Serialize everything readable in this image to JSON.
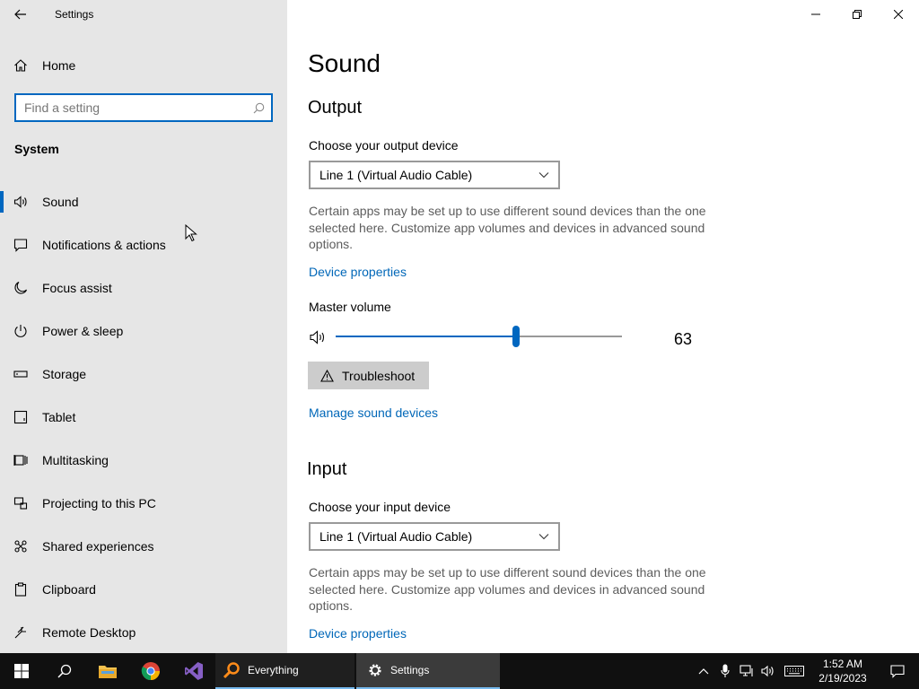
{
  "window": {
    "app_title": "Settings"
  },
  "sidebar": {
    "home_label": "Home",
    "search_placeholder": "Find a setting",
    "section_heading": "System",
    "items": [
      {
        "label": "Sound",
        "icon": "speaker-icon",
        "selected": true
      },
      {
        "label": "Notifications & actions",
        "icon": "notification-icon",
        "selected": false
      },
      {
        "label": "Focus assist",
        "icon": "moon-icon",
        "selected": false
      },
      {
        "label": "Power & sleep",
        "icon": "power-icon",
        "selected": false
      },
      {
        "label": "Storage",
        "icon": "storage-icon",
        "selected": false
      },
      {
        "label": "Tablet",
        "icon": "tablet-icon",
        "selected": false
      },
      {
        "label": "Multitasking",
        "icon": "multitasking-icon",
        "selected": false
      },
      {
        "label": "Projecting to this PC",
        "icon": "projecting-icon",
        "selected": false
      },
      {
        "label": "Shared experiences",
        "icon": "shared-experiences-icon",
        "selected": false
      },
      {
        "label": "Clipboard",
        "icon": "clipboard-icon",
        "selected": false
      },
      {
        "label": "Remote Desktop",
        "icon": "remote-desktop-icon",
        "selected": false
      }
    ]
  },
  "main": {
    "page_title": "Sound",
    "output": {
      "heading": "Output",
      "device_label": "Choose your output device",
      "device_value": "Line 1 (Virtual Audio Cable)",
      "description": "Certain apps may be set up to use different sound devices than the one selected here. Customize app volumes and devices in advanced sound options.",
      "device_properties_link": "Device properties",
      "master_volume_label": "Master volume",
      "master_volume_value": "63",
      "troubleshoot_label": "Troubleshoot",
      "manage_devices_link": "Manage sound devices"
    },
    "input": {
      "heading": "Input",
      "device_label": "Choose your input device",
      "device_value": "Line 1 (Virtual Audio Cable)",
      "description": "Certain apps may be set up to use different sound devices than the one selected here. Customize app volumes and devices in advanced sound options.",
      "device_properties_link": "Device properties"
    }
  },
  "taskbar": {
    "apps": [
      {
        "label": "Everything",
        "icon": "everything-icon"
      },
      {
        "label": "Settings",
        "icon": "settings-gear-icon"
      }
    ],
    "clock_time": "1:52 AM",
    "clock_date": "2/19/2023"
  },
  "colors": {
    "accent": "#0067c0",
    "link": "#0067b8",
    "sidebar_bg": "#e6e6e6",
    "taskbar_bg": "#101010"
  }
}
